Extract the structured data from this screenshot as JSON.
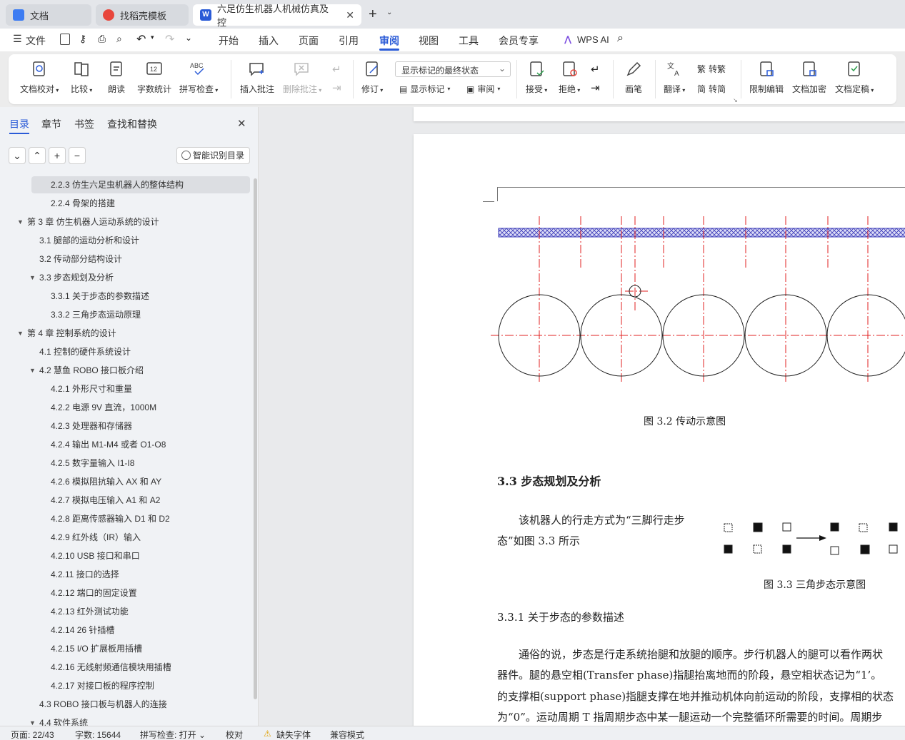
{
  "tabs": [
    {
      "label": "文档"
    },
    {
      "label": "找稻壳模板"
    },
    {
      "label": "六足仿生机器人机械仿真及控"
    }
  ],
  "menu": {
    "file": "文件",
    "items": [
      "开始",
      "插入",
      "页面",
      "引用",
      "审阅",
      "视图",
      "工具",
      "会员专享"
    ],
    "active": "审阅",
    "wps_ai": "WPS AI"
  },
  "ribbon": {
    "doc_check": "文档校对",
    "compare": "比较",
    "read_aloud": "朗读",
    "word_count": "字数统计",
    "spell_check": "拼写检查",
    "insert_comment": "插入批注",
    "delete_comment": "删除批注",
    "revise": "修订",
    "markup_state": "显示标记的最终状态",
    "show_markup": "显示标记",
    "review": "审阅",
    "accept": "接受",
    "reject": "拒绝",
    "pen": "画笔",
    "translate": "翻译",
    "to_traditional": "转繁",
    "to_simplified": "转简",
    "restrict_edit": "限制编辑",
    "encrypt": "文档加密",
    "finalize": "文档定稿"
  },
  "sidebar": {
    "tabs": [
      "目录",
      "章节",
      "书签",
      "查找和替换"
    ],
    "smart_btn": "智能识别目录",
    "toc": [
      {
        "text": "2.2.3 仿生六足虫机器人的整体结构",
        "level": 3,
        "selected": true
      },
      {
        "text": "2.2.4 骨架的搭建",
        "level": 3
      },
      {
        "text": "第 3 章   仿生机器人运动系统的设计",
        "level": 1,
        "caret": true
      },
      {
        "text": "3.1 腿部的运动分析和设计",
        "level": 2
      },
      {
        "text": "3.2 传动部分结构设计",
        "level": 2
      },
      {
        "text": "3.3 步态规划及分析",
        "level": 2,
        "caret": true
      },
      {
        "text": "3.3.1 关于步态的参数描述",
        "level": 3
      },
      {
        "text": "3.3.2  三角步态运动原理",
        "level": 3
      },
      {
        "text": "第 4 章   控制系统的设计",
        "level": 1,
        "caret": true
      },
      {
        "text": "4.1 控制的硬件系统设计",
        "level": 2
      },
      {
        "text": "4.2 慧鱼  ROBO 接口板介绍",
        "level": 2,
        "caret": true
      },
      {
        "text": "4.2.1  外形尺寸和重量",
        "level": 3
      },
      {
        "text": "4.2.2  电源 9V 直流，1000M",
        "level": 3
      },
      {
        "text": "4.2.3  处理器和存储器",
        "level": 3
      },
      {
        "text": "4.2.4  输出 M1-M4 或者 O1-O8",
        "level": 3
      },
      {
        "text": "4.2.5  数字量输入 I1-I8",
        "level": 3
      },
      {
        "text": "4.2.6  模拟阻抗输入 AX 和 AY",
        "level": 3
      },
      {
        "text": "4.2.7  模拟电压输入 A1 和 A2",
        "level": 3
      },
      {
        "text": "4.2.8  距离传感器输入 D1 和 D2",
        "level": 3
      },
      {
        "text": "4.2.9  红外线（IR）输入",
        "level": 3
      },
      {
        "text": "4.2.10 USB 接口和串口",
        "level": 3
      },
      {
        "text": "4.2.11  接口的选择",
        "level": 3
      },
      {
        "text": "4.2.12  端口的固定设置",
        "level": 3
      },
      {
        "text": "4.2.13  红外测试功能",
        "level": 3
      },
      {
        "text": "4.2.14 26 针插槽",
        "level": 3
      },
      {
        "text": "4.2.15 I/O 扩展板用插槽",
        "level": 3
      },
      {
        "text": "4.2.16  无线射频通信模块用插槽",
        "level": 3
      },
      {
        "text": "4.2.17 对接口板的程序控制",
        "level": 3
      },
      {
        "text": "4.3 ROBO 接口板与机器人的连接",
        "level": 2
      },
      {
        "text": "4.4 软件系统",
        "level": 2,
        "caret": true
      }
    ]
  },
  "document": {
    "fig32_caption": "图 3.2  传动示意图",
    "heading_33": "3.3 步态规划及分析",
    "para_gait": [
      "该机器人的行走方式为“三脚行走步",
      "态”如图 3.3 所示"
    ],
    "fig33_caption": "图 3.3  三角步态示意图",
    "heading_331": "3.3.1 关于步态的参数描述",
    "body": [
      "通俗的说，步态是行走系统抬腿和放腿的顺序。步行机器人的腿可以看作两状",
      "器件。腿的悬空相(Transfer phase)指腿抬离地而的阶段，悬空相状态记为“1’。",
      "的支撑相(support phase)指腿支撑在地并推动机体向前运动的阶段，支撑相的状态",
      "为“0”。运动周期 T 指周期步态中某一腿运动一个完整循环所需要的时间。周期步"
    ]
  },
  "status": {
    "page": "页面: 22/43",
    "words": "字数: 15644",
    "spell": "拼写检查: 打开",
    "proof": "校对",
    "missing_font": "缺失字体",
    "compat": "兼容模式"
  }
}
